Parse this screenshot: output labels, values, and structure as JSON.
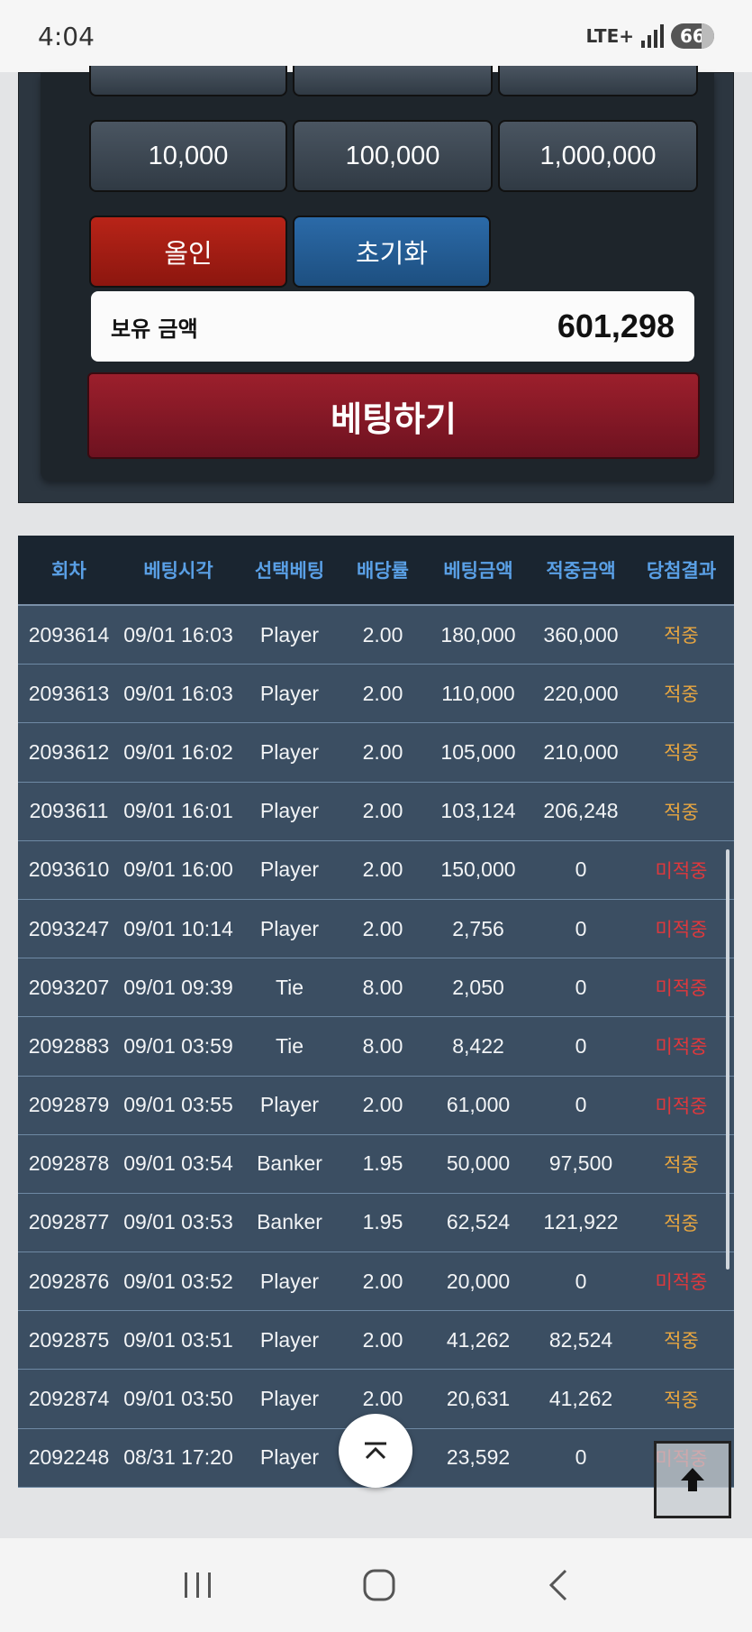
{
  "status": {
    "time": "4:04",
    "network": "LTE+",
    "battery": "66"
  },
  "panel": {
    "chips": [
      "10,000",
      "100,000",
      "1,000,000"
    ],
    "allin_label": "올인",
    "reset_label": "초기화",
    "balance_label": "보유 금액",
    "balance_value": "601,298",
    "bet_label": "베팅하기"
  },
  "history": {
    "columns": [
      "회차",
      "베팅시각",
      "선택베팅",
      "배당률",
      "베팅금액",
      "적중금액",
      "당첨결과"
    ],
    "rows": [
      [
        "2093614",
        "09/01 16:03",
        "Player",
        "2.00",
        "180,000",
        "360,000",
        "적중"
      ],
      [
        "2093613",
        "09/01 16:03",
        "Player",
        "2.00",
        "110,000",
        "220,000",
        "적중"
      ],
      [
        "2093612",
        "09/01 16:02",
        "Player",
        "2.00",
        "105,000",
        "210,000",
        "적중"
      ],
      [
        "2093611",
        "09/01 16:01",
        "Player",
        "2.00",
        "103,124",
        "206,248",
        "적중"
      ],
      [
        "2093610",
        "09/01 16:00",
        "Player",
        "2.00",
        "150,000",
        "0",
        "미적중"
      ],
      [
        "2093247",
        "09/01 10:14",
        "Player",
        "2.00",
        "2,756",
        "0",
        "미적중"
      ],
      [
        "2093207",
        "09/01 09:39",
        "Tie",
        "8.00",
        "2,050",
        "0",
        "미적중"
      ],
      [
        "2092883",
        "09/01 03:59",
        "Tie",
        "8.00",
        "8,422",
        "0",
        "미적중"
      ],
      [
        "2092879",
        "09/01 03:55",
        "Player",
        "2.00",
        "61,000",
        "0",
        "미적중"
      ],
      [
        "2092878",
        "09/01 03:54",
        "Banker",
        "1.95",
        "50,000",
        "97,500",
        "적중"
      ],
      [
        "2092877",
        "09/01 03:53",
        "Banker",
        "1.95",
        "62,524",
        "121,922",
        "적중"
      ],
      [
        "2092876",
        "09/01 03:52",
        "Player",
        "2.00",
        "20,000",
        "0",
        "미적중"
      ],
      [
        "2092875",
        "09/01 03:51",
        "Player",
        "2.00",
        "41,262",
        "82,524",
        "적중"
      ],
      [
        "2092874",
        "09/01 03:50",
        "Player",
        "2.00",
        "20,631",
        "41,262",
        "적중"
      ],
      [
        "2092248",
        "08/31 17:20",
        "Player",
        "",
        "23,592",
        "0",
        "미적중"
      ]
    ]
  },
  "colors": {
    "hit": "#e8a640",
    "miss": "#e0383c",
    "header_text": "#5aa0e6"
  }
}
